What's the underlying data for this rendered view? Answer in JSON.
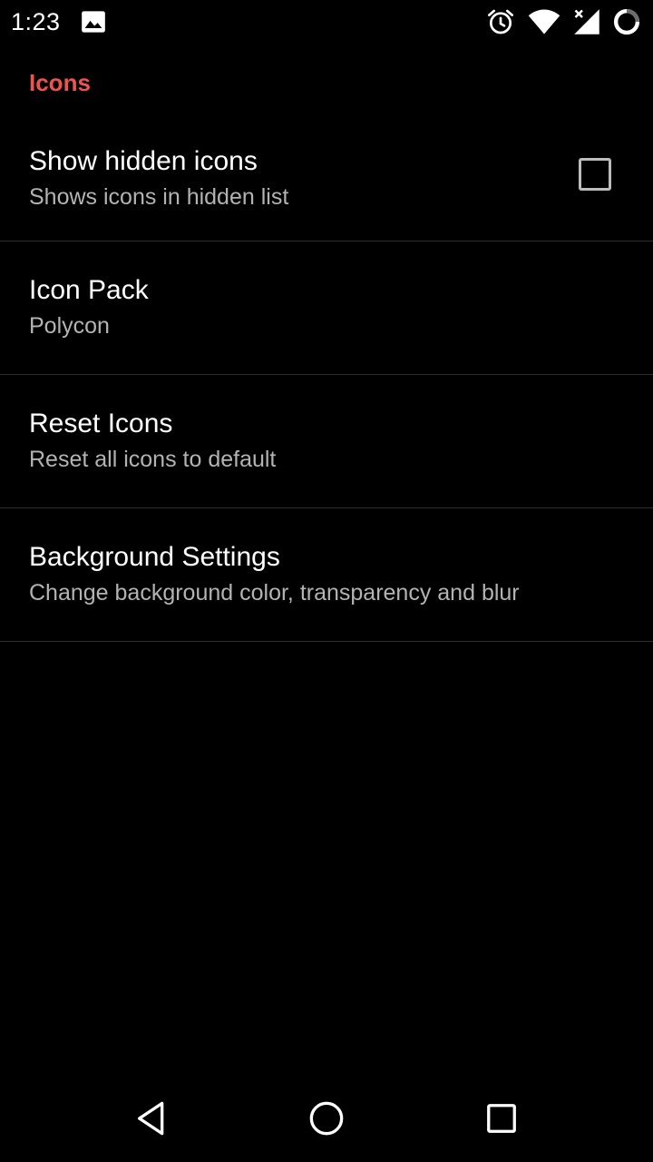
{
  "status_bar": {
    "time": "1:23",
    "icons": [
      "image-notification-icon",
      "alarm-icon",
      "wifi-icon",
      "cell-signal-icon",
      "battery-icon"
    ]
  },
  "settings": {
    "category": "Icons",
    "items": [
      {
        "title": "Show hidden icons",
        "summary": "Shows icons in hidden list",
        "checked": false
      },
      {
        "title": "Icon Pack",
        "summary": "Polycon"
      },
      {
        "title": "Reset Icons",
        "summary": "Reset all icons to default"
      },
      {
        "title": "Background Settings",
        "summary": "Change background color, transparency and blur"
      }
    ]
  },
  "nav_bar": {
    "buttons": [
      "back-icon",
      "home-icon",
      "recents-icon"
    ]
  },
  "colors": {
    "background": "#000000",
    "accent": "#ef5350",
    "title_text": "#ffffff",
    "summary_text": "#b3b3b3",
    "divider": "#2e2e2e"
  }
}
